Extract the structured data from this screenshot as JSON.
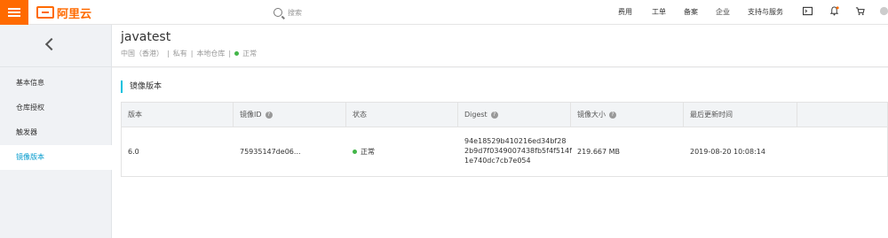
{
  "brand": {
    "name": "阿里云"
  },
  "search": {
    "placeholder": "搜索"
  },
  "top_nav": {
    "items": [
      "费用",
      "工单",
      "备案",
      "企业",
      "支持与服务"
    ]
  },
  "sidebar": {
    "items": [
      {
        "label": "基本信息"
      },
      {
        "label": "仓库授权"
      },
      {
        "label": "触发器"
      },
      {
        "label": "镜像版本"
      }
    ]
  },
  "repo": {
    "title": "javatest",
    "meta_region": "中国（香港）",
    "meta_visibility": "私有",
    "meta_source": "本地仓库",
    "meta_status": "正常"
  },
  "section": {
    "title": "镜像版本"
  },
  "table": {
    "headers": [
      "版本",
      "镜像ID",
      "状态",
      "Digest",
      "镜像大小",
      "最后更新时间"
    ],
    "rows": [
      {
        "version": "6.0",
        "image_id": "75935147de06...",
        "status": "正常",
        "digest_line1": "94e18529b410216ed34bf28",
        "digest_line2": "2b9d7f0349007438fb5f4f514f",
        "digest_line3": "1e740dc7cb7e054",
        "size": "219.667 MB",
        "updated": "2019-08-20 10:08:14"
      }
    ]
  },
  "colors": {
    "brand": "#ff6a00",
    "accent": "#00c1de",
    "status_ok": "#43b649",
    "active_link": "#0099cc"
  }
}
